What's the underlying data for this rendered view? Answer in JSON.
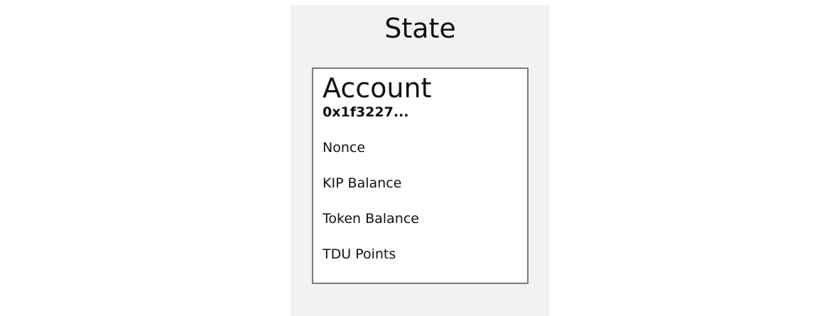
{
  "state": {
    "title": "State",
    "account": {
      "title": "Account",
      "address": "0x1f3227...",
      "fields": [
        "Nonce",
        "KIP Balance",
        "Token Balance",
        "TDU Points"
      ]
    }
  },
  "colors": {
    "panel_background": "#f2f2f2",
    "box_border": "#7a7a7a",
    "text": "#111111"
  }
}
